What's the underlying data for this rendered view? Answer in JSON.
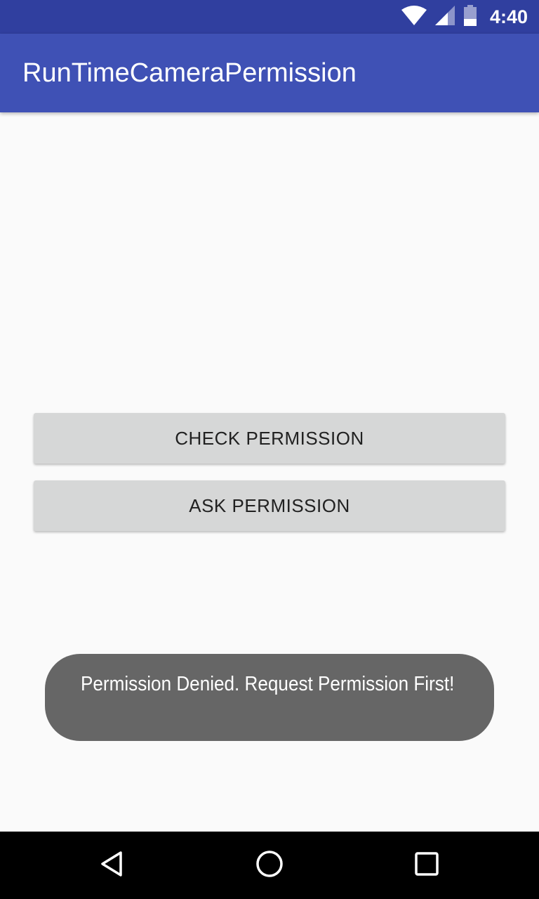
{
  "status_bar": {
    "time": "4:40",
    "icons": [
      "wifi-icon",
      "cell-signal-icon",
      "battery-icon"
    ]
  },
  "app_bar": {
    "title": "RunTimeCameraPermission"
  },
  "buttons": {
    "check_permission": "CHECK PERMISSION",
    "ask_permission": "ASK PERMISSION"
  },
  "toast": {
    "message": "Permission Denied. Request Permission First!"
  },
  "nav_bar": {
    "icons": [
      "back-icon",
      "home-icon",
      "recents-icon"
    ]
  },
  "colors": {
    "status_bar": "#303f9f",
    "app_bar": "#3f51b5",
    "background": "#fafafa",
    "button": "#d6d7d7",
    "toast": "#666666",
    "nav_bar": "#000000"
  }
}
